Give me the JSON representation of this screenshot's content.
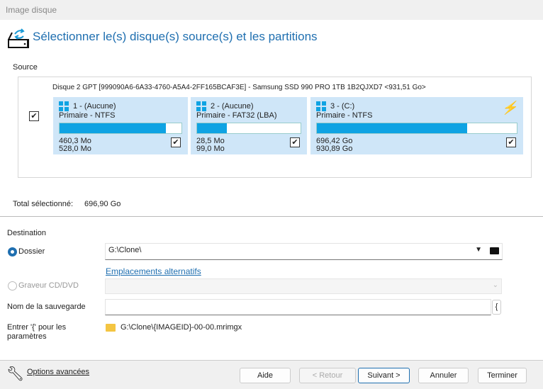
{
  "window": {
    "title": "Image disque"
  },
  "heading": "Sélectionner le(s) disque(s) source(s) et les partitions",
  "source": {
    "label": "Source",
    "disk_title": "Disque 2 GPT [999090A6-6A33-4760-A5A4-2FF165BCAF3E] - Samsung SSD 990 PRO 1TB 1B2QJXD7  <931,51 Go>",
    "disk_checked": true,
    "partitions": [
      {
        "name": "1 -  (Aucune)",
        "type": "Primaire - NTFS",
        "used": "460,3 Mo",
        "total": "528,0 Mo",
        "fill_pct": 87,
        "checked": true
      },
      {
        "name": "2 -  (Aucune)",
        "type": "Primaire - FAT32 (LBA)",
        "used": "28,5 Mo",
        "total": "99,0 Mo",
        "fill_pct": 29,
        "checked": true
      },
      {
        "name": "3 -  (C:)",
        "type": "Primaire - NTFS",
        "used": "696,42 Go",
        "total": "930,89 Go",
        "fill_pct": 75,
        "checked": true
      }
    ]
  },
  "total": {
    "label": "Total sélectionné:",
    "value": "696,90 Go"
  },
  "destination": {
    "label": "Destination",
    "folder_label": "Dossier",
    "folder_value": "G:\\Clone\\",
    "alt_link": "Emplacements alternatifs",
    "cd_label": "Graveur CD/DVD",
    "name_label": "Nom de la sauvegarde",
    "name_value": "",
    "brace": "{",
    "hint1": "Entrer '{' pour les",
    "hint2": "paramètres",
    "preview": "G:\\Clone\\{IMAGEID}-00-00.mrimgx"
  },
  "footer": {
    "advanced": "Options avancées",
    "help": "Aide",
    "back": "< Retour",
    "next": "Suivant >",
    "cancel": "Annuler",
    "finish": "Terminer"
  },
  "colors": {
    "accent": "#1f6fb0",
    "bar": "#0fa3e3",
    "partition_bg": "#cfe6f8"
  }
}
